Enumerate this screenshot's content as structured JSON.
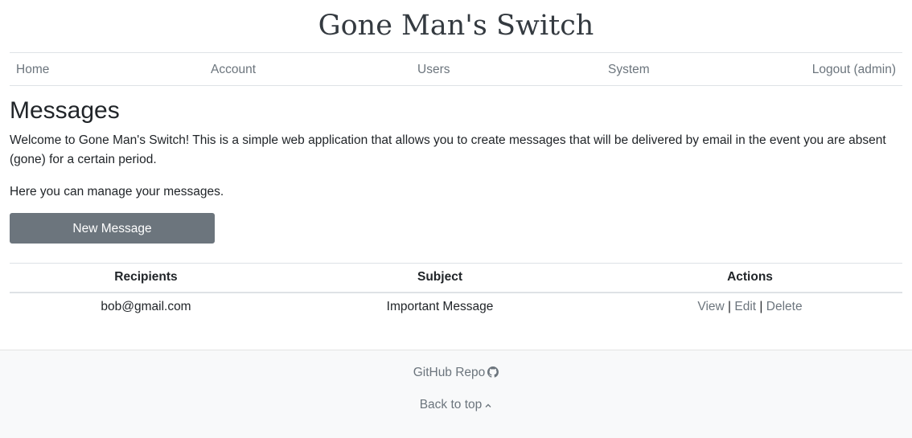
{
  "header": {
    "title": "Gone Man's Switch"
  },
  "nav": {
    "home": "Home",
    "account": "Account",
    "users": "Users",
    "system": "System",
    "logout": "Logout (admin)"
  },
  "main": {
    "title": "Messages",
    "intro": "Welcome to Gone Man's Switch! This is a simple web application that allows you to create messages that will be delivered by email in the event you are absent (gone) for a certain period.",
    "manage_text": "Here you can manage your messages.",
    "new_message_label": "New Message"
  },
  "table": {
    "headers": [
      "Recipients",
      "Subject",
      "Actions"
    ],
    "rows": [
      {
        "recipients": "bob@gmail.com",
        "subject": "Important Message",
        "view_label": "View",
        "edit_label": "Edit",
        "delete_label": "Delete",
        "separator": "|"
      }
    ]
  },
  "footer": {
    "github_label": "GitHub Repo",
    "github_icon": "github-icon",
    "back_to_top_label": "Back to top",
    "back_to_top_icon": "chevron-up-icon"
  },
  "colors": {
    "link_gray": "#6c757d",
    "button_bg": "#6c757d",
    "footer_bg": "#f8f9fa",
    "border": "#dee2e6"
  }
}
